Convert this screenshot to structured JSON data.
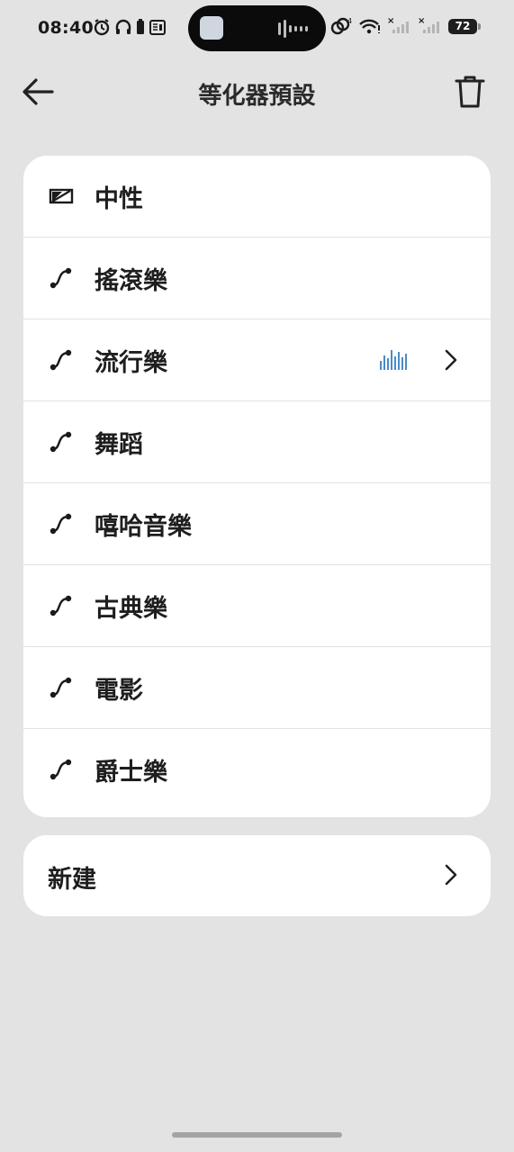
{
  "status_bar": {
    "time": "08:40",
    "battery": "72"
  },
  "header": {
    "title": "等化器預設"
  },
  "presets": [
    {
      "label": "中性",
      "icon": "neutral-eq-icon",
      "selected": false
    },
    {
      "label": "搖滾樂",
      "icon": "curve-icon",
      "selected": false
    },
    {
      "label": "流行樂",
      "icon": "curve-icon",
      "selected": true
    },
    {
      "label": "舞蹈",
      "icon": "curve-icon",
      "selected": false
    },
    {
      "label": "嘻哈音樂",
      "icon": "curve-icon",
      "selected": false
    },
    {
      "label": "古典樂",
      "icon": "curve-icon",
      "selected": false
    },
    {
      "label": "電影",
      "icon": "curve-icon",
      "selected": false
    },
    {
      "label": "爵士樂",
      "icon": "curve-icon",
      "selected": false
    }
  ],
  "new_item": {
    "label": "新建"
  },
  "colors": {
    "background": "#e3e3e3",
    "card": "#ffffff",
    "accent": "#4a8cc8"
  }
}
